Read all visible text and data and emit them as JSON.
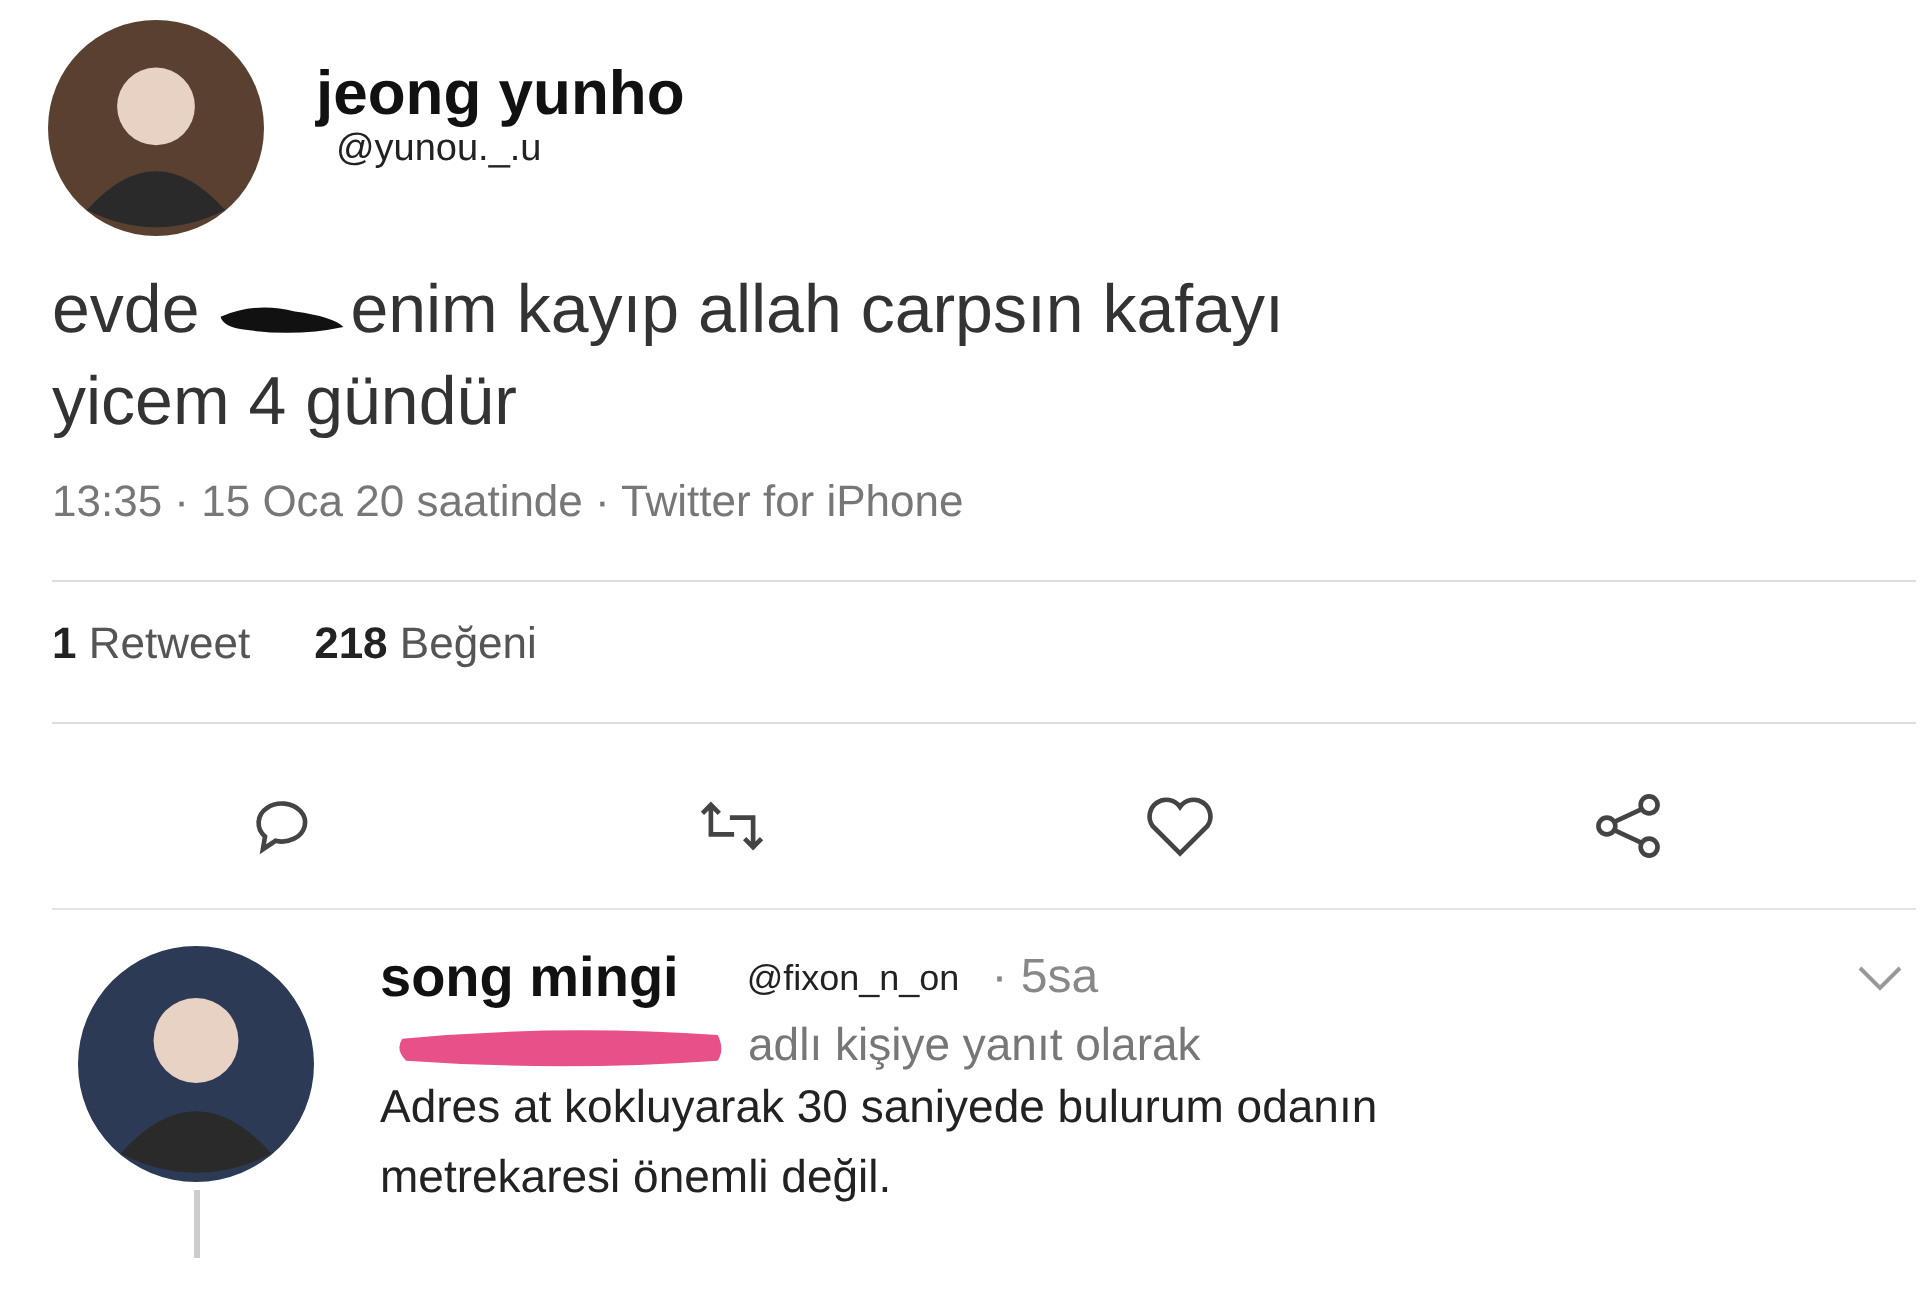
{
  "tweet": {
    "author": {
      "name": "jeong yunho",
      "handle": "@yunou._.u"
    },
    "lines": [
      [
        {
          "kind": "text",
          "text": "evde "
        },
        {
          "kind": "scribble"
        },
        {
          "kind": "text",
          "text": "enim kayıp allah carpsın kafayı"
        }
      ],
      [
        {
          "kind": "text",
          "text": "yicem 4 gündür"
        }
      ]
    ],
    "meta": "13:35 · 15 Oca 20 saatinde · Twitter for iPhone",
    "stats": [
      {
        "count": "1",
        "label": "Retweet"
      },
      {
        "count": "218",
        "label": "Beğeni"
      }
    ],
    "actions": [
      {
        "kind": "reply"
      },
      {
        "kind": "retweet"
      },
      {
        "kind": "like"
      },
      {
        "kind": "share"
      }
    ]
  },
  "reply": {
    "author": {
      "name": "song mingi",
      "handle": "@fixon_n_on"
    },
    "time": "· 5sa",
    "reply_to": [
      {
        "kind": "marker"
      },
      {
        "kind": "text",
        "text": "adlı kişiye yanıt olarak"
      }
    ],
    "lines": [
      "Adres at kokluyarak 30 saniyede bulurum odanın",
      "metrekaresi önemli değil."
    ]
  }
}
